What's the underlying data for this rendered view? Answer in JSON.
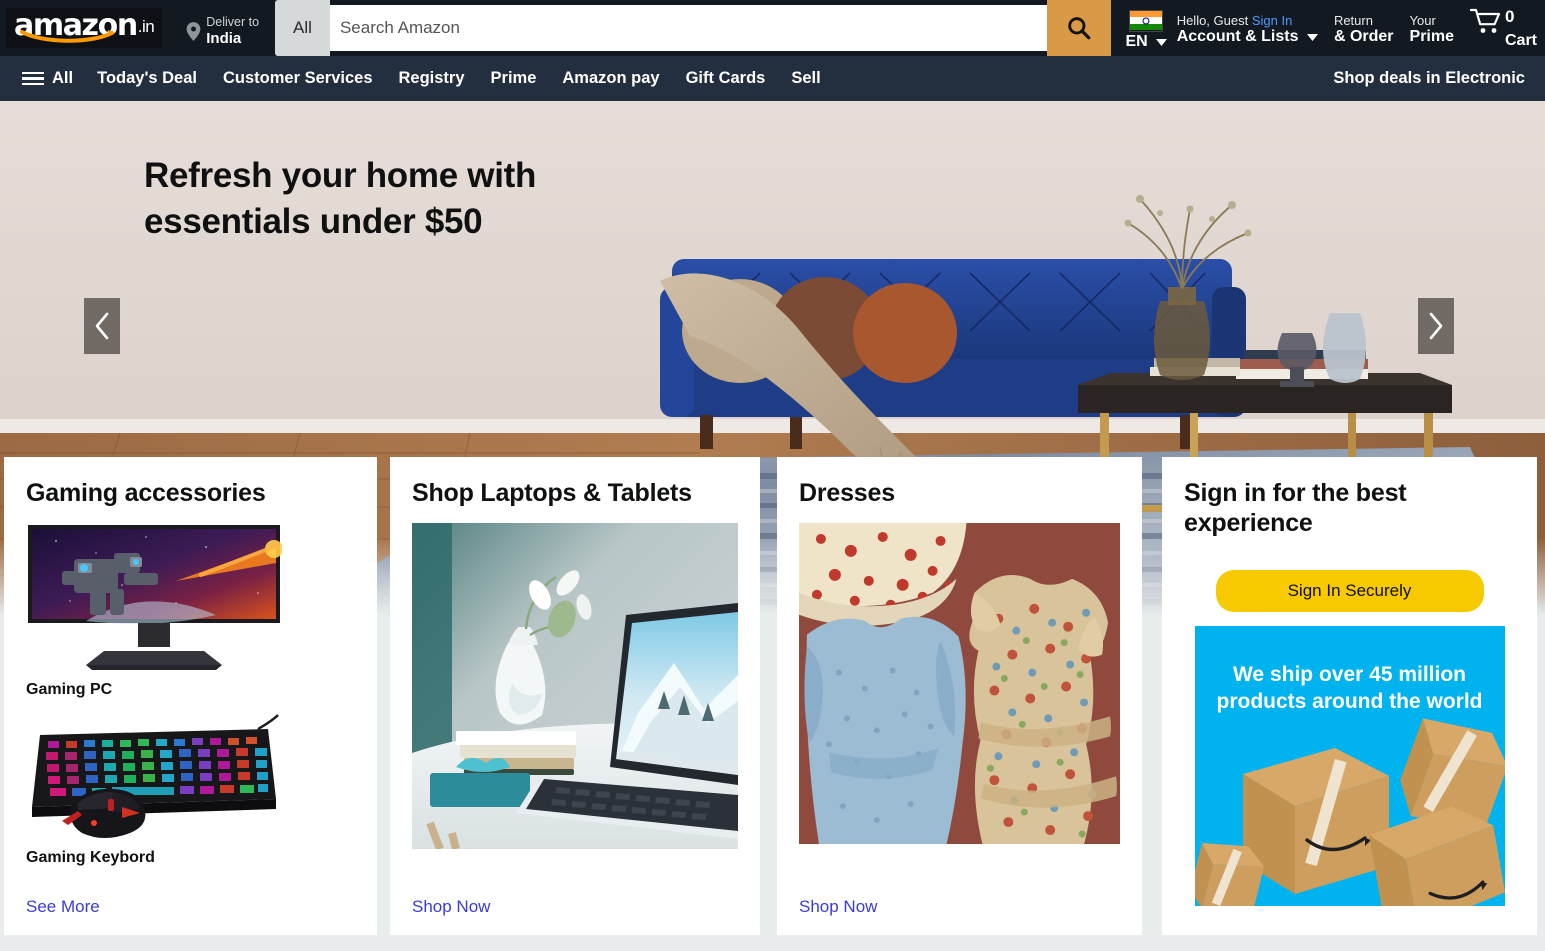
{
  "header": {
    "logo_text": "amazon",
    "logo_tld": ".in",
    "deliver_label": "Deliver to",
    "deliver_country": "India",
    "search_category": "All",
    "search_value": "",
    "search_placeholder": "Search Amazon",
    "search_icon": "search-icon",
    "language_code": "EN",
    "account_line1_greeting": "Hello, Guest ",
    "account_line1_signin": "Sign In",
    "account_line2": "Account & Lists",
    "orders_line1": "Return",
    "orders_line2": "& Order",
    "prime_line1": "Your",
    "prime_line2": "Prime",
    "cart_count": "0",
    "cart_label": "Cart"
  },
  "nav": {
    "all_label": "All",
    "items": [
      {
        "label": "Today's Deal"
      },
      {
        "label": "Customer Services"
      },
      {
        "label": "Registry"
      },
      {
        "label": "Prime"
      },
      {
        "label": "Amazon pay"
      },
      {
        "label": "Gift Cards"
      },
      {
        "label": "Sell"
      }
    ],
    "right_promo": "Shop deals in Electronic"
  },
  "hero": {
    "headline": "Refresh your home with essentials under $50",
    "prev_icon": "chevron-left-icon",
    "next_icon": "chevron-right-icon"
  },
  "cards": {
    "gaming": {
      "title": "Gaming accessories",
      "tiles": [
        {
          "label": "Gaming PC"
        },
        {
          "label": "Gaming Keybord"
        }
      ],
      "link": "See More"
    },
    "laptops": {
      "title": "Shop Laptops & Tablets",
      "link": "Shop Now"
    },
    "dresses": {
      "title": "Dresses",
      "link": "Shop Now"
    },
    "signin": {
      "title": "Sign in for the best experience",
      "button": "Sign In Securely",
      "promo_text": "We ship over 45 million products around the world"
    }
  },
  "colors": {
    "topbar_bg": "#131921",
    "navbar_bg": "#232f3e",
    "search_button": "#d99a48",
    "signin_button": "#f7ca00",
    "link_blue": "#3b3bd6",
    "signin_link": "#4b9cff",
    "promo_blue": "#00b3ef",
    "page_bg": "#eaeded"
  }
}
